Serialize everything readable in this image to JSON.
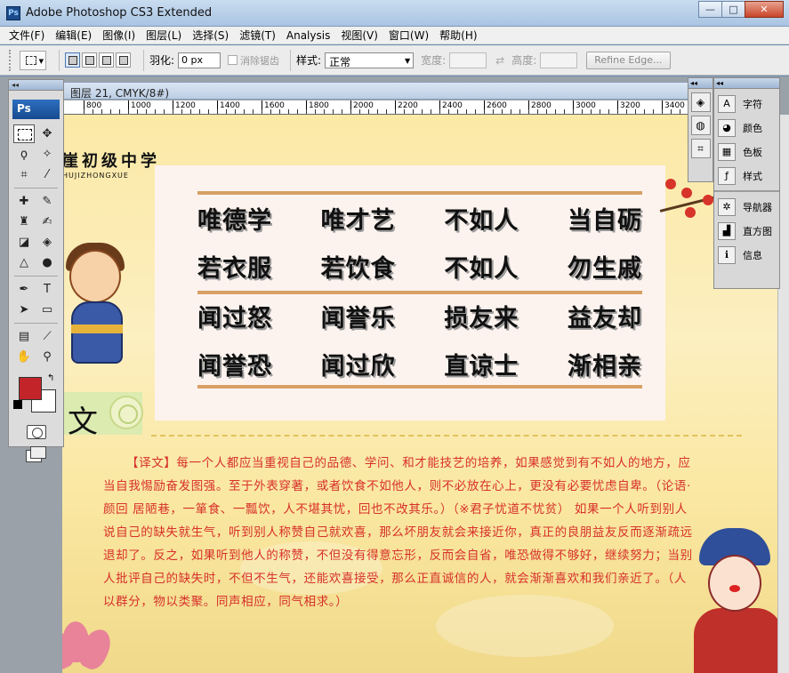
{
  "window": {
    "title": "Adobe Photoshop CS3 Extended",
    "app_icon": "Ps",
    "minimize": "—",
    "maximize": "□",
    "close": "✕"
  },
  "menu": [
    "文件(F)",
    "编辑(E)",
    "图像(I)",
    "图层(L)",
    "选择(S)",
    "滤镜(T)",
    "Analysis",
    "视图(V)",
    "窗口(W)",
    "帮助(H)"
  ],
  "options": {
    "feather_label": "羽化:",
    "feather_value": "0 px",
    "antialias_label": "消除锯齿",
    "style_label": "样式:",
    "style_value": "正常",
    "width_label": "宽度:",
    "height_label": "高度:",
    "refine_edge": "Refine Edge..."
  },
  "document": {
    "tab_title": "图层 21, CMYK/8#)",
    "ruler_ticks": [
      "800",
      "1000",
      "1200",
      "1400",
      "1600",
      "1800",
      "2000",
      "2200",
      "2400",
      "2600",
      "2800",
      "3000",
      "3200",
      "3400"
    ]
  },
  "tools_panel": {
    "logo": "Ps",
    "foreground_color": "#c3242a",
    "background_color": "#ffffff"
  },
  "canvas": {
    "school_name": "崖初级中学",
    "school_pinyin": "HUJIZHONGXUE",
    "poem_rows": [
      [
        "唯德学",
        "唯才艺",
        "不如人",
        "当自砺"
      ],
      [
        "若衣服",
        "若饮食",
        "不如人",
        "勿生戚"
      ],
      [
        "闻过怒",
        "闻誉乐",
        "损友来",
        "益友却"
      ],
      [
        "闻誉恐",
        "闻过欣",
        "直谅士",
        "渐相亲"
      ]
    ],
    "section_char": "文",
    "translation": "【译文】每一个人都应当重视自己的品德、学问、和才能技艺的培养，如果感觉到有不如人的地方，应当自我惕励奋发图强。至于外表穿著，或者饮食不如他人，则不必放在心上，更没有必要忧虑自卑。（论语·颜回 居陋巷，一箪食、一瓢饮，人不堪其忧，回也不改其乐。）（※君子忧道不忧贫） 如果一个人听到别人说自己的缺失就生气，听到别人称赞自己就欢喜，那么坏朋友就会来接近你，真正的良朋益友反而逐渐疏远退却了。反之，如果听到他人的称赞，不但没有得意忘形，反而会自省，唯恐做得不够好，继续努力；当别人批评自己的缺失时，不但不生气，还能欢喜接受，那么正直诚信的人，就会渐渐喜欢和我们亲近了。（人以群分，物以类聚。同声相应，同气相求。）"
  },
  "right_panel": {
    "group1": [
      "字符",
      "颜色",
      "色板",
      "样式"
    ],
    "group2": [
      "导航器",
      "直方图",
      "信息"
    ]
  }
}
